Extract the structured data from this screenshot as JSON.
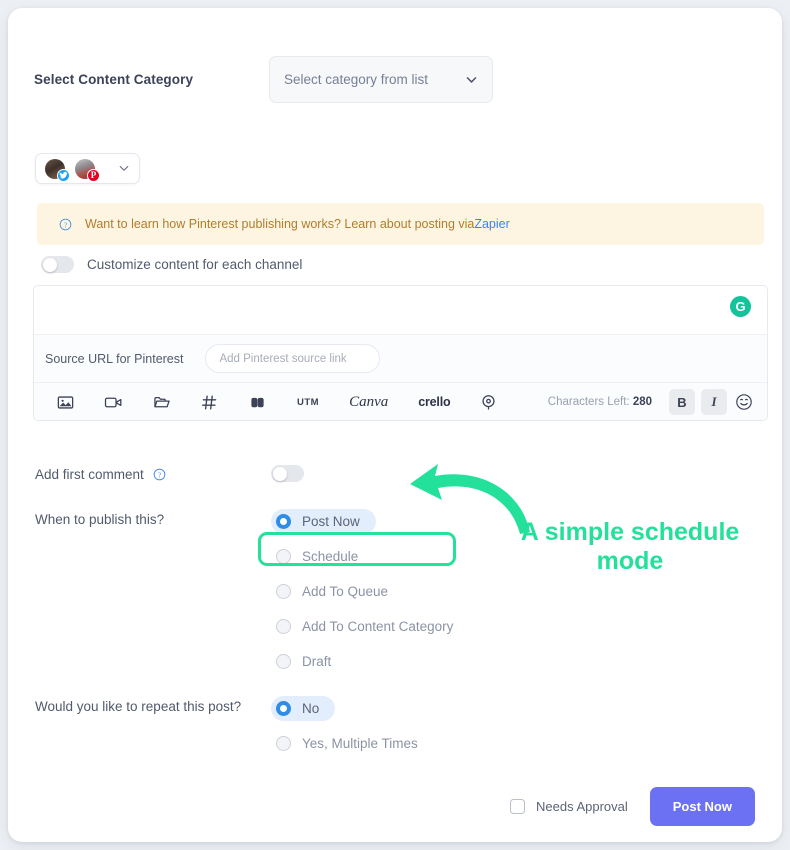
{
  "content_category": {
    "label": "Select Content Category",
    "select_placeholder": "Select category from list",
    "chevron_icon": "chevron-down-icon"
  },
  "accounts": {
    "avatars": [
      {
        "name": "account-avatar-twitter",
        "network": "twitter",
        "badge_icon": "twitter-bird-icon"
      },
      {
        "name": "account-avatar-pinterest",
        "network": "pinterest",
        "badge_icon": "pinterest-p-icon",
        "badge_text": "P"
      }
    ],
    "chevron_icon": "chevron-down-icon"
  },
  "banner": {
    "icon": "question-circle-icon",
    "text": "Want to learn how Pinterest publishing works? Learn about posting via ",
    "link_text": "Zapier",
    "background": "#fdf5e2",
    "text_color": "#b07d2b",
    "link_color": "#3b82f6"
  },
  "customize": {
    "label": "Customize content for each channel",
    "toggle_state": "off"
  },
  "composer": {
    "grammarly_icon_letter": "G",
    "grammarly_color": "#15c39a",
    "source_url_label": "Source URL for Pinterest",
    "source_url_placeholder": "Add Pinterest source link",
    "source_url_value": "",
    "toolbar": [
      {
        "name": "insert-image-icon",
        "type": "icon",
        "label": ""
      },
      {
        "name": "insert-video-icon",
        "type": "icon",
        "label": ""
      },
      {
        "name": "media-library-folder-icon",
        "type": "icon",
        "label": ""
      },
      {
        "name": "hashtag-icon",
        "type": "icon",
        "label": ""
      },
      {
        "name": "link-shortener-icon",
        "type": "icon",
        "label": ""
      },
      {
        "name": "utm-button",
        "type": "text",
        "label": "UTM"
      },
      {
        "name": "canva-button",
        "type": "text",
        "label": "Canva"
      },
      {
        "name": "crello-button",
        "type": "text",
        "label": "crello"
      },
      {
        "name": "location-pin-icon",
        "type": "icon",
        "label": ""
      }
    ],
    "characters_left_label": "Characters Left:",
    "characters_left_value": "280",
    "bold_label": "B",
    "italic_label": "I",
    "emoji_icon": "smiley-face-icon"
  },
  "first_comment": {
    "label": "Add first comment",
    "help_icon": "question-circle-icon",
    "toggle_state": "off"
  },
  "publish": {
    "label": "When to publish this?",
    "options": [
      {
        "label": "Post Now",
        "selected": true
      },
      {
        "label": "Schedule",
        "selected": false
      },
      {
        "label": "Add To Queue",
        "selected": false
      },
      {
        "label": "Add To Content Category",
        "selected": false
      },
      {
        "label": "Draft",
        "selected": false
      }
    ]
  },
  "repeat": {
    "label": "Would you like to repeat this post?",
    "options": [
      {
        "label": "No",
        "selected": true
      },
      {
        "label": "Yes, Multiple Times",
        "selected": false
      }
    ]
  },
  "footer": {
    "needs_approval_label": "Needs Approval",
    "needs_approval_checked": false,
    "submit_label": "Post Now",
    "submit_color": "#6b71f2"
  },
  "annotation": {
    "text_line1": "A simple schedule",
    "text_line2": "mode",
    "color": "#23e09a",
    "highlights": "Schedule"
  }
}
